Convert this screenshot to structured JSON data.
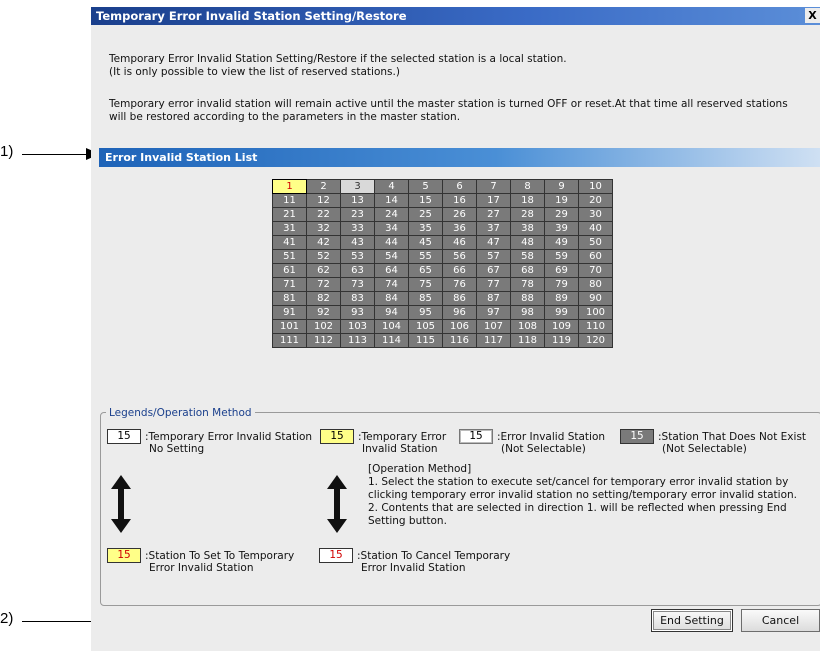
{
  "callouts": [
    "1)",
    "2)"
  ],
  "window": {
    "title": "Temporary Error Invalid Station Setting/Restore",
    "close_label": "X"
  },
  "description": {
    "line1": "Temporary Error Invalid Station Setting/Restore if the selected station is a local station.",
    "line2": "(It is only possible to view the list of reserved stations.)",
    "line3": "Temporary error invalid station will remain active until the master station is turned OFF or reset.At that time all reserved stations",
    "line4": "will be restored according to the parameters in the master station."
  },
  "section_title": "Error Invalid Station List",
  "stations": {
    "rows": [
      [
        "1",
        "2",
        "3",
        "4",
        "5",
        "6",
        "7",
        "8",
        "9",
        "10"
      ],
      [
        "11",
        "12",
        "13",
        "14",
        "15",
        "16",
        "17",
        "18",
        "19",
        "20"
      ],
      [
        "21",
        "22",
        "23",
        "24",
        "25",
        "26",
        "27",
        "28",
        "29",
        "30"
      ],
      [
        "31",
        "32",
        "33",
        "34",
        "35",
        "36",
        "37",
        "38",
        "39",
        "40"
      ],
      [
        "41",
        "42",
        "43",
        "44",
        "45",
        "46",
        "47",
        "48",
        "49",
        "50"
      ],
      [
        "51",
        "52",
        "53",
        "54",
        "55",
        "56",
        "57",
        "58",
        "59",
        "60"
      ],
      [
        "61",
        "62",
        "63",
        "64",
        "65",
        "66",
        "67",
        "68",
        "69",
        "70"
      ],
      [
        "71",
        "72",
        "73",
        "74",
        "75",
        "76",
        "77",
        "78",
        "79",
        "80"
      ],
      [
        "81",
        "82",
        "83",
        "84",
        "85",
        "86",
        "87",
        "88",
        "89",
        "90"
      ],
      [
        "91",
        "92",
        "93",
        "94",
        "95",
        "96",
        "97",
        "98",
        "99",
        "100"
      ],
      [
        "101",
        "102",
        "103",
        "104",
        "105",
        "106",
        "107",
        "108",
        "109",
        "110"
      ],
      [
        "111",
        "112",
        "113",
        "114",
        "115",
        "116",
        "117",
        "118",
        "119",
        "120"
      ]
    ],
    "selected": [
      "1"
    ],
    "not_existing": [
      "3"
    ]
  },
  "legend": {
    "title": "Legends/Operation Method",
    "swatch_value": "15",
    "item1_line1": ":Temporary Error Invalid Station",
    "item1_line2": "No Setting",
    "item2_line1": ":Temporary Error",
    "item2_line2": "Invalid Station",
    "item3_line1": ":Error Invalid Station",
    "item3_line2": "(Not Selectable)",
    "item4_line1": ":Station That Does Not Exist",
    "item4_line2": "(Not Selectable)",
    "op_title": "[Operation Method]",
    "op_line1": "1. Select the station to execute set/cancel for temporary error invalid station by",
    "op_line2": "clicking temporary error invalid station no setting/temporary error invalid station.",
    "op_line3": "2. Contents that are selected in direction 1. will be reflected when pressing End",
    "op_line4": "Setting button.",
    "item5_line1": ":Station To Set To Temporary",
    "item5_line2": "Error Invalid Station",
    "item6_line1": ":Station To Cancel Temporary",
    "item6_line2": "Error Invalid Station"
  },
  "buttons": {
    "end_setting": "End Setting",
    "cancel": "Cancel"
  },
  "colors": {
    "title_bar": "#1a3f8c",
    "section_header": "#1e63b8",
    "cell_gray": "#7a7a7a",
    "highlight_yellow": "#ffff88",
    "highlight_red_text": "#d00000"
  }
}
